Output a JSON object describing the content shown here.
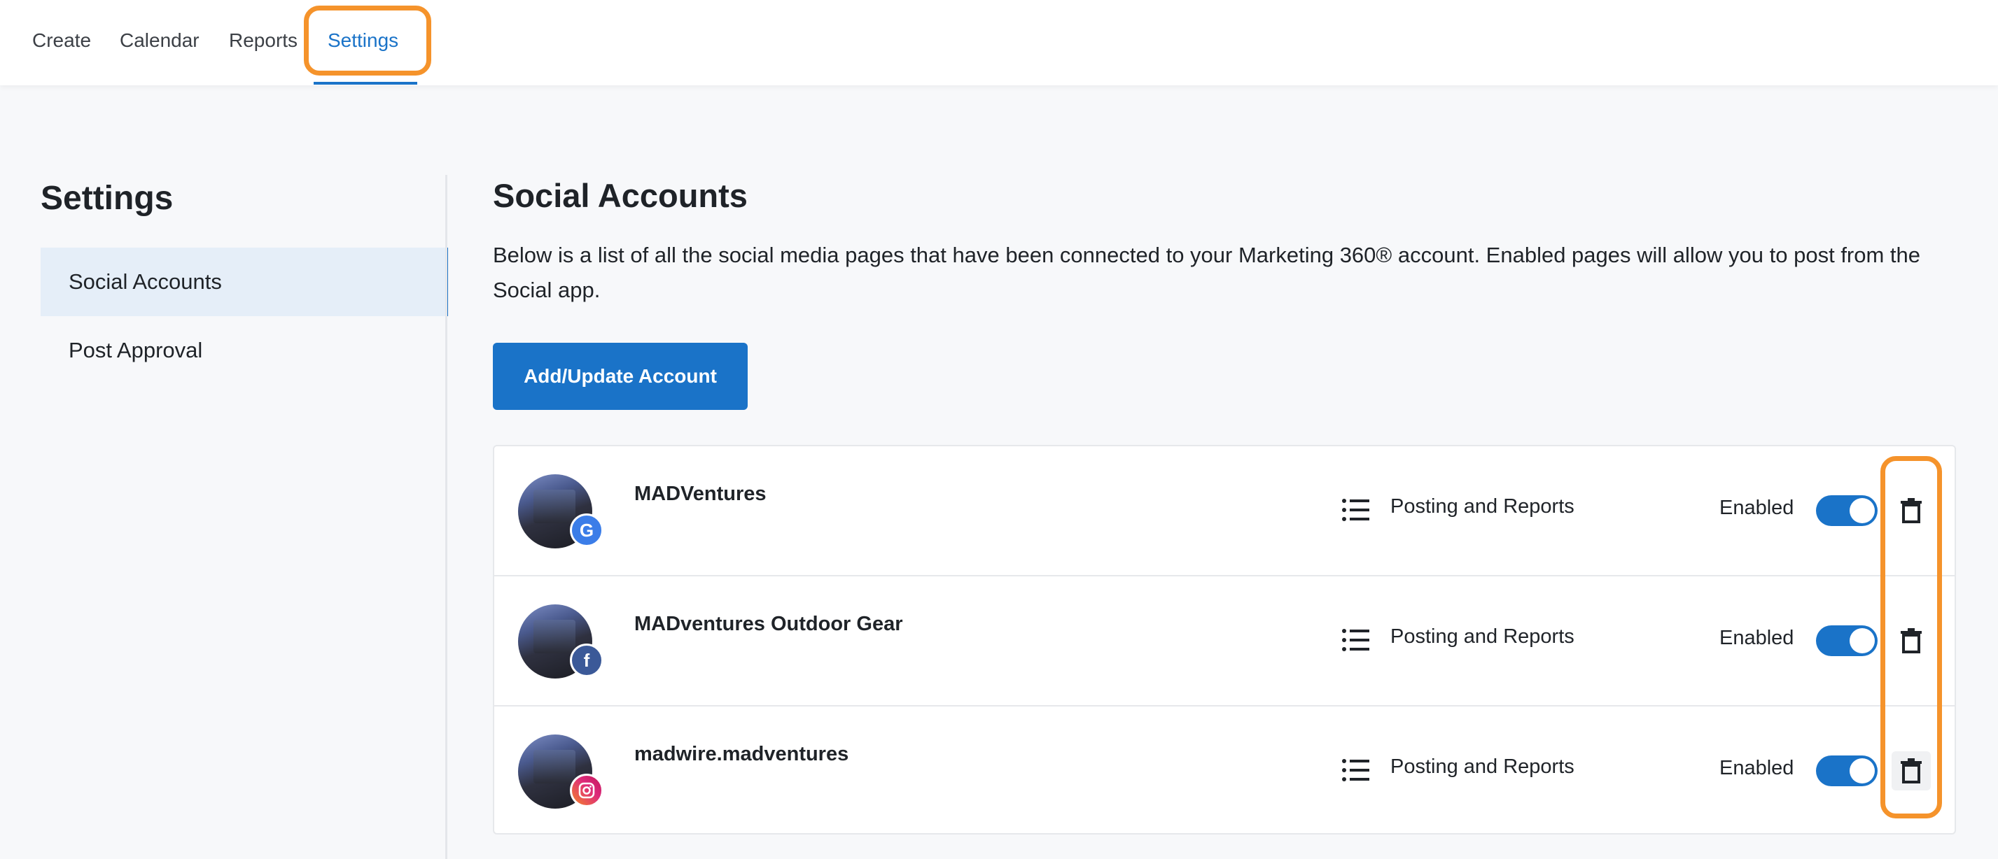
{
  "nav": {
    "items": [
      {
        "label": "Create"
      },
      {
        "label": "Calendar"
      },
      {
        "label": "Reports"
      },
      {
        "label": "Settings",
        "active": true
      }
    ]
  },
  "sidebar": {
    "title": "Settings",
    "items": [
      {
        "label": "Social Accounts",
        "active": true
      },
      {
        "label": "Post Approval"
      }
    ]
  },
  "main": {
    "title": "Social Accounts",
    "description": "Below is a list of all the social media pages that have been connected to your Marketing 360® account. Enabled pages will allow you to post from the Social app.",
    "add_button": "Add/Update Account",
    "accounts": [
      {
        "name": "MADVentures",
        "network": "google",
        "permissions": "Posting and Reports",
        "status": "Enabled",
        "enabled": true
      },
      {
        "name": "MADventures Outdoor Gear",
        "network": "facebook",
        "permissions": "Posting and Reports",
        "status": "Enabled",
        "enabled": true
      },
      {
        "name": "madwire.madventures",
        "network": "instagram",
        "permissions": "Posting and Reports",
        "status": "Enabled",
        "enabled": true
      }
    ]
  },
  "colors": {
    "accent": "#1a73c8",
    "highlight": "#f5932b"
  },
  "icons": {
    "permissions": "list-icon",
    "delete": "trash-icon"
  }
}
